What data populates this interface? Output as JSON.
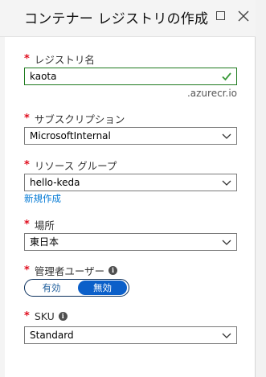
{
  "blade": {
    "title": "コンテナー レジストリの作成",
    "maximize_icon": "maximize-icon",
    "close_icon": "close-icon"
  },
  "form": {
    "required_mark": "*",
    "registry_name": {
      "label": "レジストリ名",
      "value": "kaota",
      "suffix": ".azurecr.io",
      "valid_icon": "checkmark-icon"
    },
    "subscription": {
      "label": "サブスクリプション",
      "selected": "MicrosoftInternal"
    },
    "resource_group": {
      "label": "リソース グループ",
      "selected": "hello-keda",
      "create_new_link": "新規作成"
    },
    "location": {
      "label": "場所",
      "selected": "東日本"
    },
    "admin_user": {
      "label": "管理者ユーザー",
      "info_icon": "info-icon",
      "options": [
        "有効",
        "無効"
      ],
      "selected": "無効"
    },
    "sku": {
      "label": "SKU",
      "info_icon": "info-icon",
      "selected": "Standard"
    }
  },
  "colors": {
    "required": "#e00b1c",
    "link": "#0078d4",
    "toggle_active": "#0b5fc9",
    "valid": "#1e7a1e"
  }
}
